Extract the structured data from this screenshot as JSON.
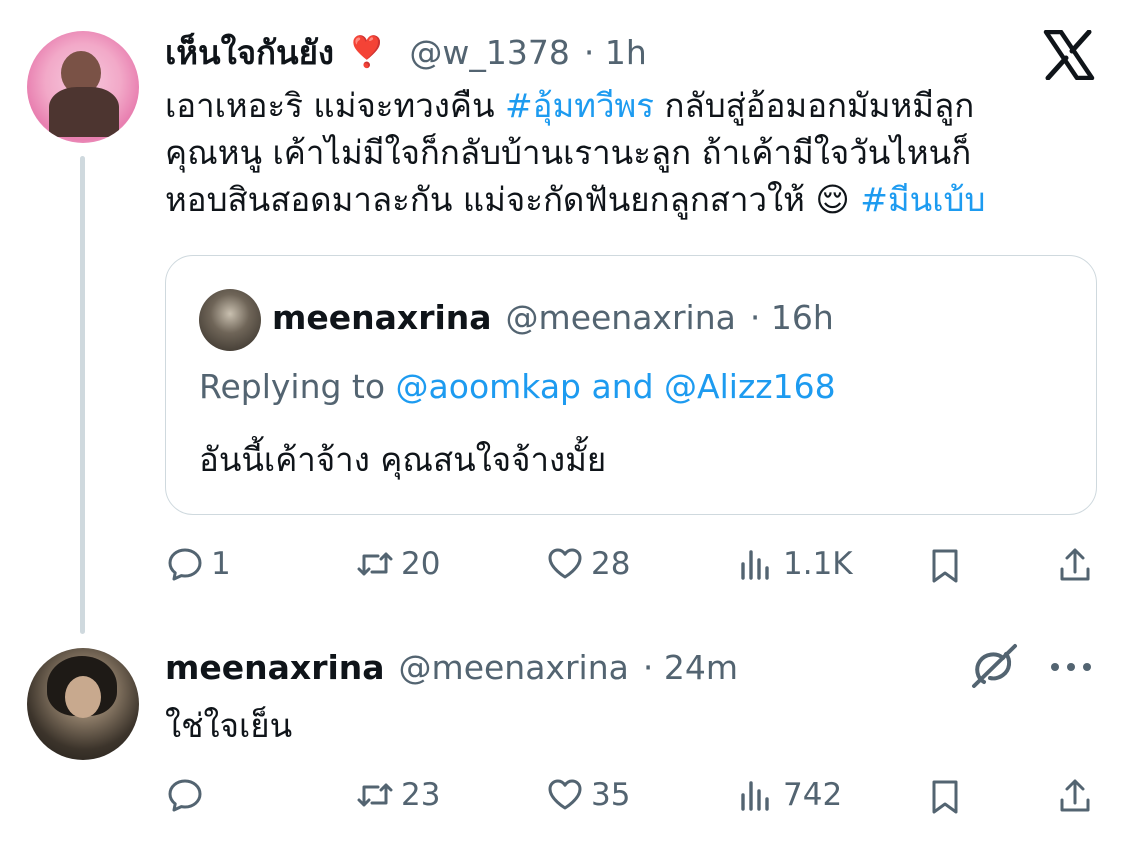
{
  "tweet1": {
    "name": "เห็นใจกันยัง",
    "name_emoji": "❣️",
    "handle": "@w_1378",
    "time": "· 1h",
    "line1_a": "เอาเหอะริ แม่จะทวงคืน ",
    "line1_tag": "#อุ้มทวีพร",
    "line1_b": " กลับสู่อ้อมอกมัมหมีลูก",
    "line2": "คุณหนู เค้าไม่มีใจก็กลับบ้านเรานะลูก ถ้าเค้ามีใจวันไหนก็",
    "line3_a": "หอบสินสอดมาละกัน แม่จะกัดฟันยกลูกสาวให้ ",
    "line3_emoji": "😌",
    "line3_tag": " #มีนเบ้บ",
    "quote": {
      "name": "meenaxrina",
      "handle": "@meenaxrina",
      "time": "· 16h",
      "replying_prefix": "Replying to ",
      "replying_users": "@aoomkap and @Alizz168",
      "text": "อันนี้เค้าจ้าง คุณสนใจจ้างมั้ย"
    },
    "actions": {
      "replies": "1",
      "retweets": "20",
      "likes": "28",
      "views": "1.1K"
    }
  },
  "tweet2": {
    "name": "meenaxrina",
    "handle": "@meenaxrina",
    "time": "· 24m",
    "text": "ใช่ใจเย็น",
    "actions": {
      "replies": "",
      "retweets": "23",
      "likes": "35",
      "views": "742"
    }
  },
  "colors": {
    "accent": "#1d9bf0",
    "muted": "#536471",
    "border": "#cfd9de",
    "text": "#0f1419"
  },
  "icons": [
    "x-logo-icon",
    "reply-icon",
    "retweet-icon",
    "like-icon",
    "views-icon",
    "bookmark-icon",
    "share-icon",
    "grok-icon",
    "more-icon"
  ]
}
